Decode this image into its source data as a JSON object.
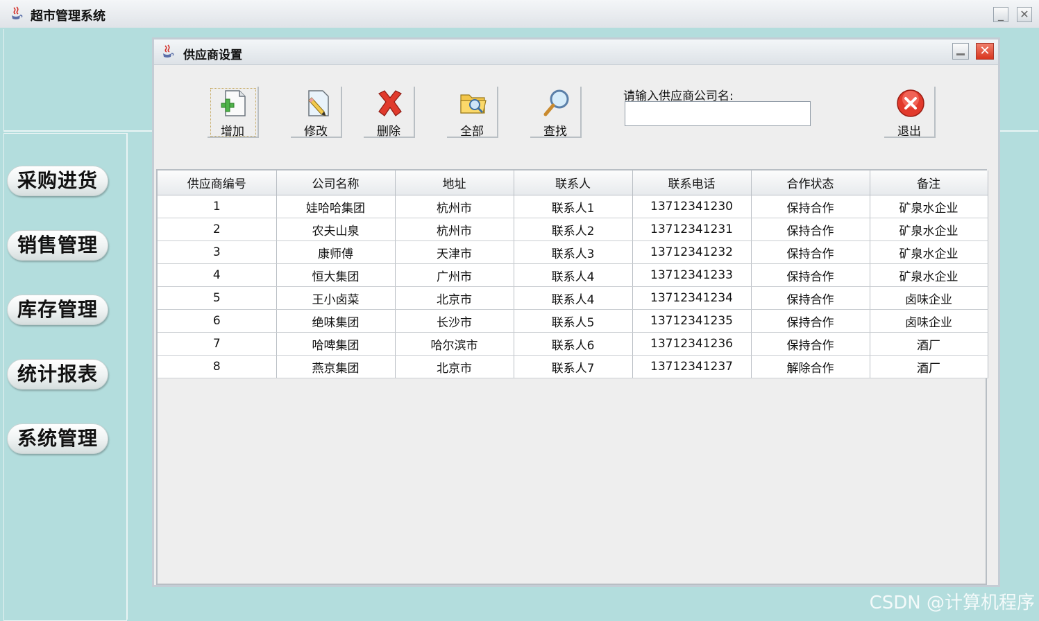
{
  "app": {
    "title": "超市管理系统",
    "minimize_label": "_",
    "close_label": "✕"
  },
  "nav": {
    "items": [
      {
        "label": "采购进货"
      },
      {
        "label": "销售管理"
      },
      {
        "label": "库存管理"
      },
      {
        "label": "统计报表"
      },
      {
        "label": "系统管理"
      }
    ]
  },
  "frame": {
    "title": "供应商设置",
    "close_label": "✕"
  },
  "toolbar": {
    "add_label": "增加",
    "edit_label": "修改",
    "delete_label": "删除",
    "all_label": "全部",
    "find_label": "查找",
    "exit_label": "退出",
    "icons": [
      "add-document-icon",
      "edit-pencil-icon",
      "delete-x-icon",
      "folder-search-icon",
      "magnifier-icon",
      "exit-circle-icon"
    ]
  },
  "search": {
    "label": "请输入供应商公司名:",
    "value": ""
  },
  "table": {
    "headers": [
      "供应商编号",
      "公司名称",
      "地址",
      "联系人",
      "联系电话",
      "合作状态",
      "备注"
    ],
    "rows": [
      [
        "1",
        "娃哈哈集团",
        "杭州市",
        "联系人1",
        "13712341230",
        "保持合作",
        "矿泉水企业"
      ],
      [
        "2",
        "农夫山泉",
        "杭州市",
        "联系人2",
        "13712341231",
        "保持合作",
        "矿泉水企业"
      ],
      [
        "3",
        "康师傅",
        "天津市",
        "联系人3",
        "13712341232",
        "保持合作",
        "矿泉水企业"
      ],
      [
        "4",
        "恒大集团",
        "广州市",
        "联系人4",
        "13712341233",
        "保持合作",
        "矿泉水企业"
      ],
      [
        "5",
        "王小卤菜",
        "北京市",
        "联系人4",
        "13712341234",
        "保持合作",
        "卤味企业"
      ],
      [
        "6",
        "绝味集团",
        "长沙市",
        "联系人5",
        "13712341235",
        "保持合作",
        "卤味企业"
      ],
      [
        "7",
        "哈啤集团",
        "哈尔滨市",
        "联系人6",
        "13712341236",
        "保持合作",
        "酒厂"
      ],
      [
        "8",
        "燕京集团",
        "北京市",
        "联系人7",
        "13712341237",
        "解除合作",
        "酒厂"
      ]
    ]
  },
  "watermark": "CSDN @计算机程序",
  "colors": {
    "desktop": "#b3dddd",
    "close_red": "#d8351e",
    "panel": "#eeeeee"
  }
}
